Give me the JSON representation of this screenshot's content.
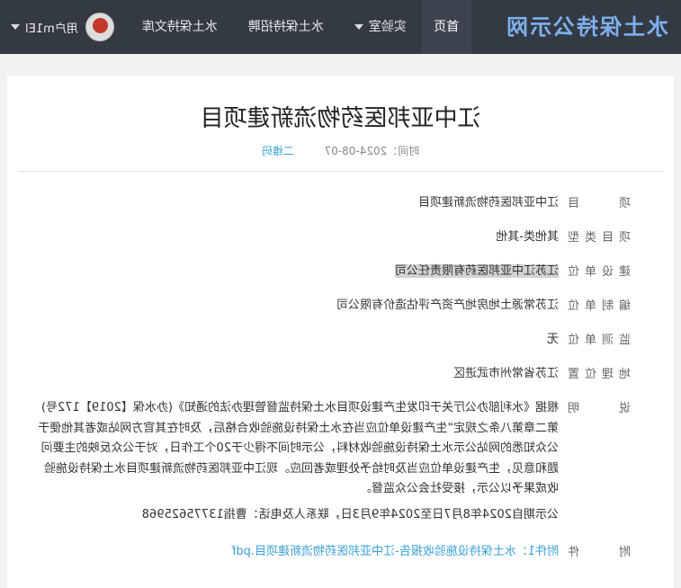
{
  "brand": "水土保持公示网",
  "nav": {
    "home": "首页",
    "lab": "实验室",
    "recruit": "水土保持招聘",
    "library": "水土保持文库",
    "user": "用户m1El"
  },
  "article": {
    "title": "江中亚邦医药物流新建项目",
    "time_label": "时间：2024-08-07",
    "views": "二维码"
  },
  "fields": [
    {
      "label": "项目",
      "value": "江中亚邦医药物流新建项目"
    },
    {
      "label": "项目类型",
      "value": "其他类-其他"
    },
    {
      "label": "建设单位",
      "value": "江苏江中亚邦医药有限责任公司"
    },
    {
      "label": "编制单位",
      "value": "江苏常源土地房地产资产评估造价有限公司"
    },
    {
      "label": "监测单位",
      "value": "无"
    },
    {
      "label": "地理位置",
      "value": "江苏省常州市武进区"
    }
  ],
  "description": {
    "label": "说明",
    "text": "根据《水利部办公厅关于印发生产建设项目水土保持监督管理办法的通知》(办水保【2019】172号)第二章第八条之规定“生产建设单位应当在水土保持设施验收合格后，及时在其官方网站或者其他便于公众知悉的网站公示水土保持设施验收材料，公示时间不得少于20个工作日，对于公众反映的主要问题和意见，生产建设单位应当及时给予处理或者回应。现江中亚邦医药物流新建项目水土保持设施验收成果予以公示，接受社会公众监督。",
    "period": "公示期自2024年8月7日至2024年9月3日，联系人及电话：曹指13775625968"
  },
  "attachment": {
    "label": "附件",
    "text": "附件1：水土保持设施验收报告-江中亚邦医药物流新建项目.pdf"
  }
}
